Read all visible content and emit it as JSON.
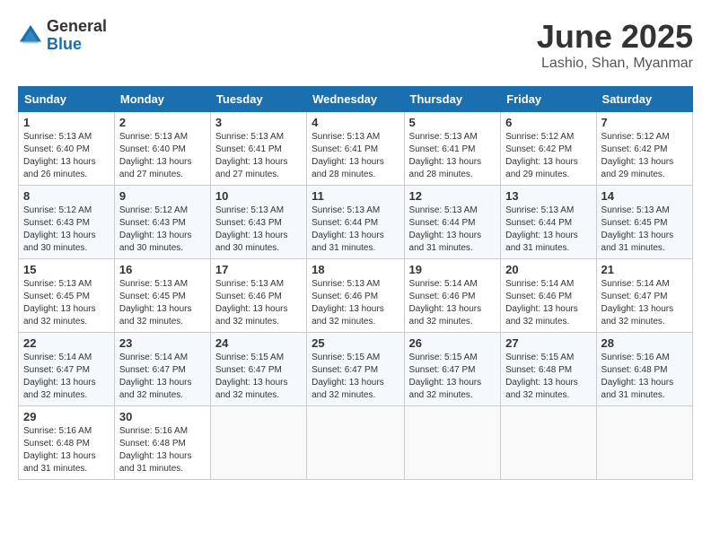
{
  "logo": {
    "general": "General",
    "blue": "Blue"
  },
  "title": {
    "month": "June 2025",
    "location": "Lashio, Shan, Myanmar"
  },
  "headers": [
    "Sunday",
    "Monday",
    "Tuesday",
    "Wednesday",
    "Thursday",
    "Friday",
    "Saturday"
  ],
  "weeks": [
    [
      {
        "day": "1",
        "info": "Sunrise: 5:13 AM\nSunset: 6:40 PM\nDaylight: 13 hours\nand 26 minutes."
      },
      {
        "day": "2",
        "info": "Sunrise: 5:13 AM\nSunset: 6:40 PM\nDaylight: 13 hours\nand 27 minutes."
      },
      {
        "day": "3",
        "info": "Sunrise: 5:13 AM\nSunset: 6:41 PM\nDaylight: 13 hours\nand 27 minutes."
      },
      {
        "day": "4",
        "info": "Sunrise: 5:13 AM\nSunset: 6:41 PM\nDaylight: 13 hours\nand 28 minutes."
      },
      {
        "day": "5",
        "info": "Sunrise: 5:13 AM\nSunset: 6:41 PM\nDaylight: 13 hours\nand 28 minutes."
      },
      {
        "day": "6",
        "info": "Sunrise: 5:12 AM\nSunset: 6:42 PM\nDaylight: 13 hours\nand 29 minutes."
      },
      {
        "day": "7",
        "info": "Sunrise: 5:12 AM\nSunset: 6:42 PM\nDaylight: 13 hours\nand 29 minutes."
      }
    ],
    [
      {
        "day": "8",
        "info": "Sunrise: 5:12 AM\nSunset: 6:43 PM\nDaylight: 13 hours\nand 30 minutes."
      },
      {
        "day": "9",
        "info": "Sunrise: 5:12 AM\nSunset: 6:43 PM\nDaylight: 13 hours\nand 30 minutes."
      },
      {
        "day": "10",
        "info": "Sunrise: 5:13 AM\nSunset: 6:43 PM\nDaylight: 13 hours\nand 30 minutes."
      },
      {
        "day": "11",
        "info": "Sunrise: 5:13 AM\nSunset: 6:44 PM\nDaylight: 13 hours\nand 31 minutes."
      },
      {
        "day": "12",
        "info": "Sunrise: 5:13 AM\nSunset: 6:44 PM\nDaylight: 13 hours\nand 31 minutes."
      },
      {
        "day": "13",
        "info": "Sunrise: 5:13 AM\nSunset: 6:44 PM\nDaylight: 13 hours\nand 31 minutes."
      },
      {
        "day": "14",
        "info": "Sunrise: 5:13 AM\nSunset: 6:45 PM\nDaylight: 13 hours\nand 31 minutes."
      }
    ],
    [
      {
        "day": "15",
        "info": "Sunrise: 5:13 AM\nSunset: 6:45 PM\nDaylight: 13 hours\nand 32 minutes."
      },
      {
        "day": "16",
        "info": "Sunrise: 5:13 AM\nSunset: 6:45 PM\nDaylight: 13 hours\nand 32 minutes."
      },
      {
        "day": "17",
        "info": "Sunrise: 5:13 AM\nSunset: 6:46 PM\nDaylight: 13 hours\nand 32 minutes."
      },
      {
        "day": "18",
        "info": "Sunrise: 5:13 AM\nSunset: 6:46 PM\nDaylight: 13 hours\nand 32 minutes."
      },
      {
        "day": "19",
        "info": "Sunrise: 5:14 AM\nSunset: 6:46 PM\nDaylight: 13 hours\nand 32 minutes."
      },
      {
        "day": "20",
        "info": "Sunrise: 5:14 AM\nSunset: 6:46 PM\nDaylight: 13 hours\nand 32 minutes."
      },
      {
        "day": "21",
        "info": "Sunrise: 5:14 AM\nSunset: 6:47 PM\nDaylight: 13 hours\nand 32 minutes."
      }
    ],
    [
      {
        "day": "22",
        "info": "Sunrise: 5:14 AM\nSunset: 6:47 PM\nDaylight: 13 hours\nand 32 minutes."
      },
      {
        "day": "23",
        "info": "Sunrise: 5:14 AM\nSunset: 6:47 PM\nDaylight: 13 hours\nand 32 minutes."
      },
      {
        "day": "24",
        "info": "Sunrise: 5:15 AM\nSunset: 6:47 PM\nDaylight: 13 hours\nand 32 minutes."
      },
      {
        "day": "25",
        "info": "Sunrise: 5:15 AM\nSunset: 6:47 PM\nDaylight: 13 hours\nand 32 minutes."
      },
      {
        "day": "26",
        "info": "Sunrise: 5:15 AM\nSunset: 6:47 PM\nDaylight: 13 hours\nand 32 minutes."
      },
      {
        "day": "27",
        "info": "Sunrise: 5:15 AM\nSunset: 6:48 PM\nDaylight: 13 hours\nand 32 minutes."
      },
      {
        "day": "28",
        "info": "Sunrise: 5:16 AM\nSunset: 6:48 PM\nDaylight: 13 hours\nand 31 minutes."
      }
    ],
    [
      {
        "day": "29",
        "info": "Sunrise: 5:16 AM\nSunset: 6:48 PM\nDaylight: 13 hours\nand 31 minutes."
      },
      {
        "day": "30",
        "info": "Sunrise: 5:16 AM\nSunset: 6:48 PM\nDaylight: 13 hours\nand 31 minutes."
      },
      {
        "day": "",
        "info": ""
      },
      {
        "day": "",
        "info": ""
      },
      {
        "day": "",
        "info": ""
      },
      {
        "day": "",
        "info": ""
      },
      {
        "day": "",
        "info": ""
      }
    ]
  ]
}
